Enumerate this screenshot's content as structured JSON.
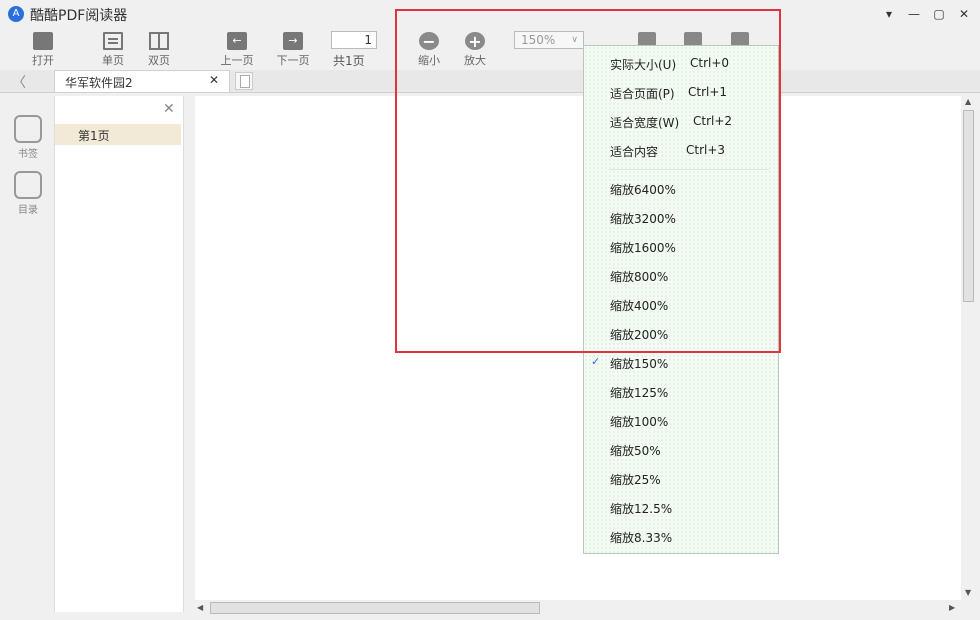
{
  "window": {
    "app_title": "酷酷PDF阅读器",
    "logo_glyph": "A",
    "controls": {
      "dropdown": "▾",
      "minimize": "—",
      "maximize": "▢",
      "close": "✕"
    }
  },
  "toolbar": {
    "open": "打开",
    "single_page": "单页",
    "double_page": "双页",
    "prev_page": "上一页",
    "next_page": "下一页",
    "page_value": "1",
    "page_total": "共1页",
    "zoom_out": "缩小",
    "zoom_in": "放大",
    "zoom_value": "150%"
  },
  "tabs": {
    "doc_name": "华军软件园2",
    "close_glyph": "✕",
    "back_glyph": "〈"
  },
  "rail": {
    "bookmarks": "书签",
    "toc": "目录"
  },
  "panel": {
    "close_glyph": "✕",
    "items": [
      "第1页"
    ]
  },
  "zoom_menu": {
    "fit": [
      {
        "label": "实际大小(U)",
        "shortcut": "Ctrl+0"
      },
      {
        "label": "适合页面(P)",
        "shortcut": "Ctrl+1"
      },
      {
        "label": "适合宽度(W)",
        "shortcut": "Ctrl+2"
      },
      {
        "label": "适合内容",
        "shortcut": "Ctrl+3"
      }
    ],
    "levels": [
      "缩放6400%",
      "缩放3200%",
      "缩放1600%",
      "缩放800%",
      "缩放400%",
      "缩放200%",
      "缩放150%",
      "缩放125%",
      "缩放100%",
      "缩放50%",
      "缩放25%",
      "缩放12.5%",
      "缩放8.33%"
    ],
    "checked": "缩放150%",
    "check_glyph": "✓"
  },
  "colors": {
    "highlight": "#e0343c",
    "selected_item_bg": "#f2ead6",
    "menu_bg": "#f4faf4"
  }
}
